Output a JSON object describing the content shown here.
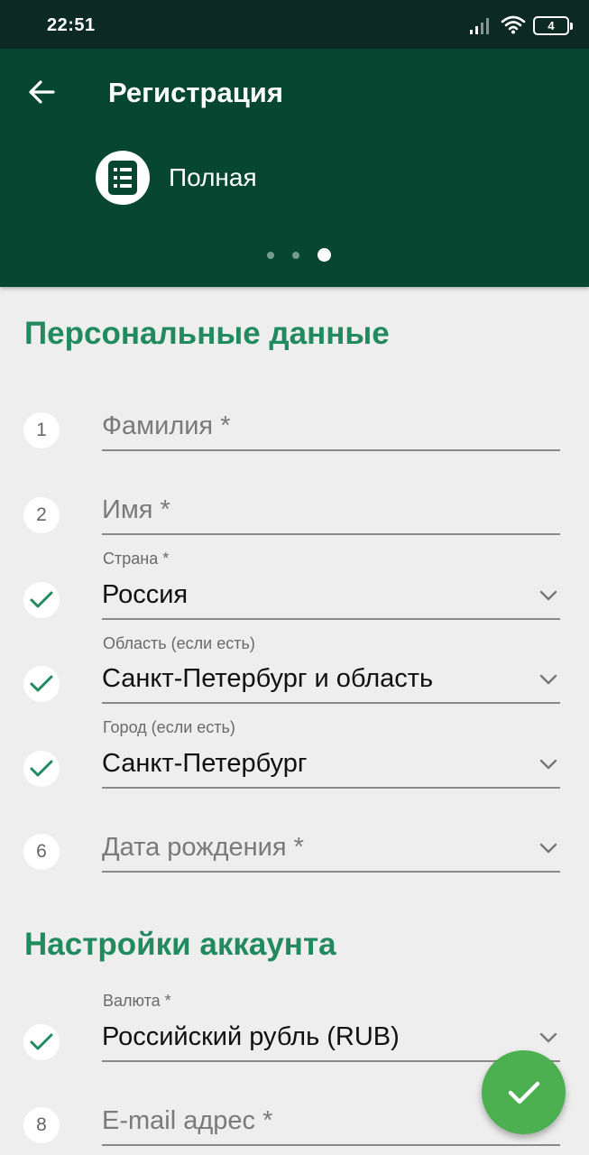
{
  "status_bar": {
    "time": "22:51",
    "battery_level": "4"
  },
  "app_bar": {
    "title": "Регистрация",
    "registration_type": "Полная",
    "page_count": 3,
    "active_page": 3
  },
  "sections": {
    "personal": "Персональные данные",
    "account": "Настройки аккаунта"
  },
  "fields": {
    "surname": {
      "marker": "1",
      "placeholder": "Фамилия *"
    },
    "name": {
      "marker": "2",
      "placeholder": "Имя *"
    },
    "country": {
      "label": "Страна *",
      "value": "Россия"
    },
    "region": {
      "label": "Область (если есть)",
      "value": "Санкт-Петербург и область"
    },
    "city": {
      "label": "Город (если есть)",
      "value": "Санкт-Петербург"
    },
    "birthdate": {
      "marker": "6",
      "placeholder": "Дата рождения *"
    },
    "currency": {
      "label": "Валюта *",
      "value": "Российский рубль (RUB)"
    },
    "email": {
      "marker": "8",
      "placeholder": "E-mail адрес *"
    }
  },
  "colors": {
    "status_bar_bg": "#0c2a21",
    "app_bar_bg": "#074732",
    "accent": "#218a5f",
    "fab": "#4caf50"
  },
  "icons": {
    "back": "arrow-left-icon",
    "type": "list-document-icon",
    "check": "check-icon",
    "dropdown": "chevron-down-icon",
    "fab": "check-icon"
  }
}
